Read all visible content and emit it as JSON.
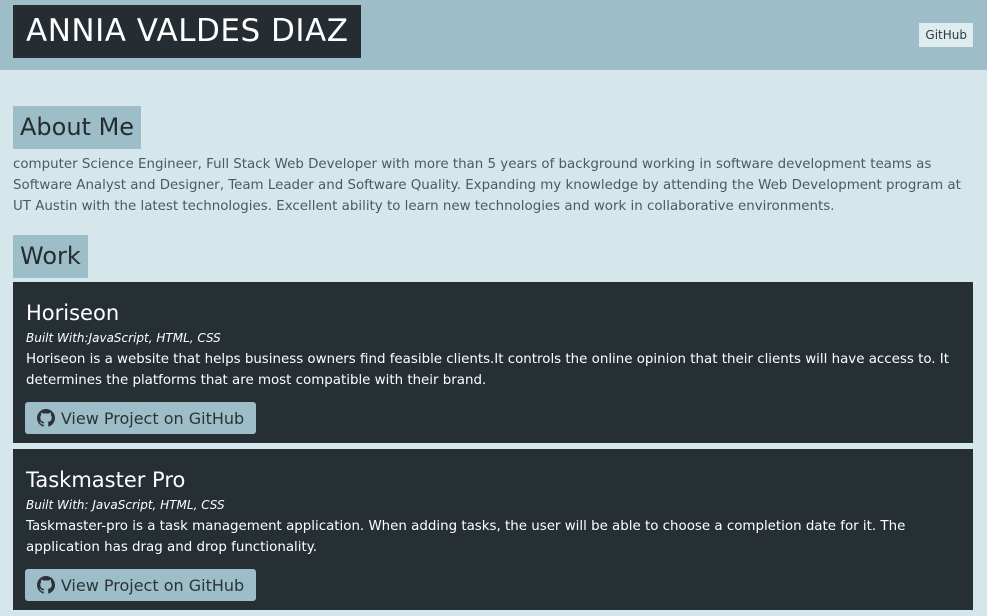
{
  "header": {
    "title": "ANNIA VALDES DIAZ",
    "nav_link": "GitHub"
  },
  "about": {
    "heading": "About Me",
    "text": "computer Science Engineer, Full Stack Web Developer with more than 5 years of background working in software development teams as Software Analyst and Designer, Team Leader and Software Quality. Expanding my knowledge by attending the Web Development program at UT Austin with the latest technologies. Excellent ability to learn new technologies and work in collaborative environments."
  },
  "work": {
    "heading": "Work",
    "projects": [
      {
        "title": "Horiseon",
        "built_with": "Built With:JavaScript, HTML, CSS",
        "description": "Horiseon is a website that helps business owners find feasible clients.It controls the online opinion that their clients will have access to. It determines the platforms that are most compatible with their brand.",
        "button_label": "View Project on GitHub",
        "button_icon": "github-icon"
      },
      {
        "title": "Taskmaster Pro",
        "built_with": "Built With: JavaScript, HTML, CSS",
        "description": "Taskmaster-pro is a task management application. When adding tasks, the user will be able to choose a completion date for it. The application has drag and drop functionality.",
        "button_label": "View Project on GitHub",
        "button_icon": "github-icon"
      }
    ]
  },
  "colors": {
    "page_background": "#d6e7ec",
    "header_background": "#9dbdc8",
    "dark": "#252d33",
    "card_background": "#262f34",
    "button_background": "#9dbdc8"
  }
}
